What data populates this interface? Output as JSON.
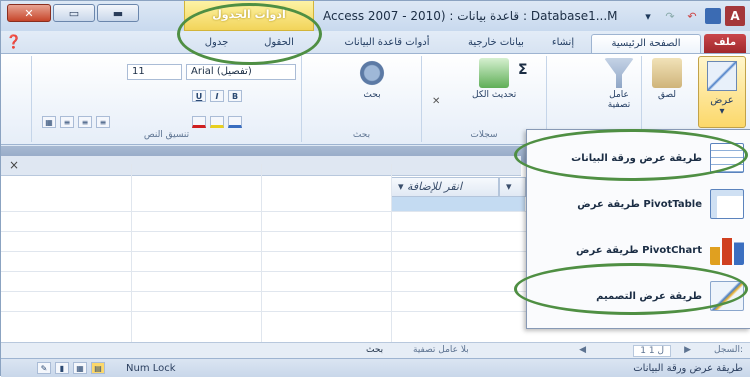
{
  "window": {
    "title": "Access 2007 - 2010) : قاعدة بيانات : Database1...M",
    "contextual_tab_title": "أدوات الجدول",
    "close_symbol": "✕",
    "restore_symbol": "▭",
    "minimize_symbol": "▬",
    "qat_dropdown": "▾",
    "undo": "↶",
    "redo": "↷",
    "app_icon": "A"
  },
  "tabs": {
    "file": "ملف",
    "home": "الصفحة الرئيسية",
    "create": "إنشاء",
    "external": "بيانات خارجية",
    "dbtools": "أدوات قاعدة البيانات",
    "fields": "الحقول",
    "table": "جدول"
  },
  "ribbon": {
    "view_label": "عرض",
    "paste_label": "لصق",
    "filter_label": "عامل تصفية",
    "refresh_label": "تحديث الكل",
    "records_group": "سجلات",
    "find_group": "بحث",
    "find_label": "بحث",
    "text_group": "تنسيق النص",
    "font_name": "Arial (تفصيل)",
    "font_size": "11",
    "bold": "B",
    "italic": "I",
    "underline": "U",
    "sigma": "Σ",
    "delete_x": "✕"
  },
  "grid": {
    "close_x": "×",
    "col_add": "انقر للإضافة",
    "col_dropdown": "▾"
  },
  "menu": {
    "items": [
      {
        "label": "طريقة عرض ورقة البيانات",
        "icon": "datasheet-icon"
      },
      {
        "label": "طريقة عرض PivotTable",
        "icon": "pivottable-icon"
      },
      {
        "label": "طريقة عرض PivotChart",
        "icon": "pivotchart-icon"
      },
      {
        "label": "طريقة عرض التصميم",
        "icon": "design-view-icon"
      }
    ]
  },
  "navbar": {
    "record_label": "السجل:",
    "record_pos": "1 ل 1",
    "filter_status": "بلا عامل تصفية",
    "search": "بحث",
    "first": "◀",
    "last": "▶"
  },
  "statusbar": {
    "view_name": "طريقة عرض ورقة البيانات",
    "num_lock": "Num Lock"
  },
  "colors": {
    "file_tab": "#a0282c",
    "highlight_oval": "#4f8f43",
    "contextual_tab": "#f2d45a"
  }
}
